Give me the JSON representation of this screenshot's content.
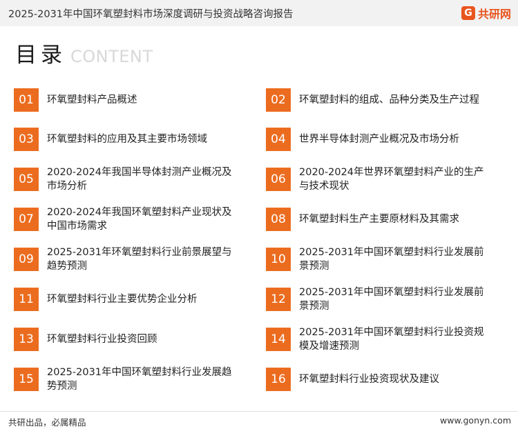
{
  "header": {
    "report_title": "2025-2031年中国环氧塑封料市场深度调研与投资战略咨询报告",
    "logo_text": "共研网",
    "logo_mark": "G"
  },
  "heading": {
    "title_cn": "目录",
    "title_en": "CONTENT"
  },
  "toc": [
    {
      "num": "01",
      "text": "环氧塑封料产品概述"
    },
    {
      "num": "02",
      "text": "环氧塑封料的组成、品种分类及生产过程"
    },
    {
      "num": "03",
      "text": "环氧塑封料的应用及其主要市场领域"
    },
    {
      "num": "04",
      "text": "世界半导体封测产业概况及市场分析"
    },
    {
      "num": "05",
      "text": "2020-2024年我国半导体封测产业概况及市场分析"
    },
    {
      "num": "06",
      "text": "2020-2024年世界环氧塑封料产业的生产与技术现状"
    },
    {
      "num": "07",
      "text": "2020-2024年我国环氧塑封料产业现状及中国市场需求"
    },
    {
      "num": "08",
      "text": "环氧塑封料生产主要原材料及其需求"
    },
    {
      "num": "09",
      "text": "2025-2031年环氧塑封料行业前景展望与趋势预测"
    },
    {
      "num": "10",
      "text": "2025-2031年中国环氧塑封料行业发展前景预测"
    },
    {
      "num": "11",
      "text": "环氧塑封料行业主要优势企业分析"
    },
    {
      "num": "12",
      "text": "2025-2031年中国环氧塑封料行业发展前景预测"
    },
    {
      "num": "13",
      "text": "环氧塑封料行业投资回顾"
    },
    {
      "num": "14",
      "text": "2025-2031年中国环氧塑封料行业投资规模及增速预测"
    },
    {
      "num": "15",
      "text": "2025-2031年中国环氧塑封料行业发展趋势预测"
    },
    {
      "num": "16",
      "text": "环氧塑封料行业投资现状及建议"
    }
  ],
  "footer": {
    "slogan": "共研出品，必属精品",
    "website": "www.gonyn.com"
  },
  "colors": {
    "accent": "#ec6c1f",
    "logo": "#e8551f"
  }
}
